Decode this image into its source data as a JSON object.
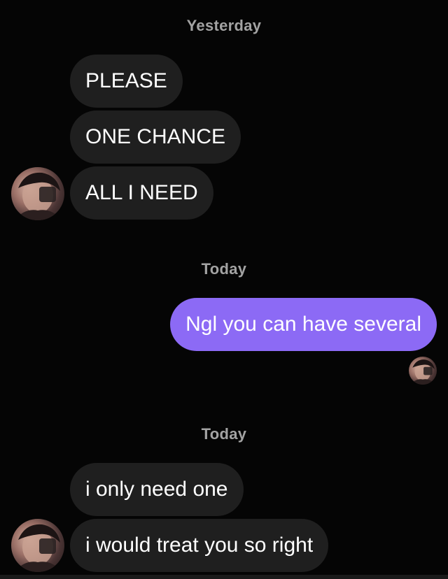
{
  "conversation": {
    "groups": [
      {
        "day_label": "Yesterday",
        "messages": [
          {
            "text": "PLEASE",
            "sender": "them"
          },
          {
            "text": "ONE CHANCE",
            "sender": "them"
          },
          {
            "text": "ALL I NEED",
            "sender": "them"
          }
        ]
      },
      {
        "day_label": "Today",
        "messages": [
          {
            "text": "Ngl you can have several",
            "sender": "me"
          }
        ]
      },
      {
        "day_label": "Today",
        "messages": [
          {
            "text": "i only need one",
            "sender": "them"
          },
          {
            "text": "i would treat you so right",
            "sender": "them"
          }
        ]
      }
    ]
  },
  "colors": {
    "background": "#050505",
    "incoming_bubble": "#1f1f1f",
    "outgoing_bubble": "#8c6af5",
    "day_label": "#a3a3a3"
  },
  "icons": {
    "contact_avatar": "contact-avatar-icon",
    "seen_avatar": "seen-avatar-icon"
  }
}
